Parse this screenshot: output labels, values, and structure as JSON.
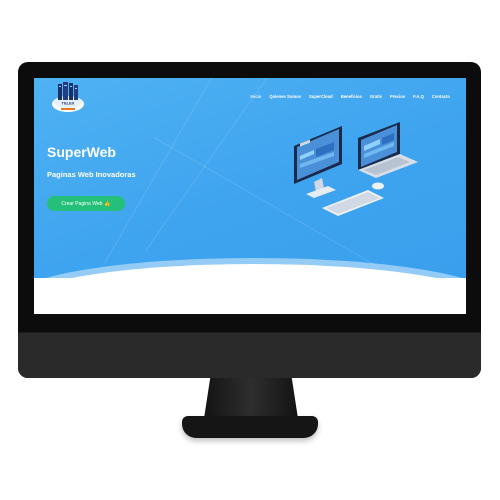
{
  "nav": {
    "items": [
      {
        "label": "Inicio",
        "active": true
      },
      {
        "label": "Quienes Somos"
      },
      {
        "label": "SuperCloud"
      },
      {
        "label": "Beneficios"
      },
      {
        "label": "Gratis"
      },
      {
        "label": "Precios"
      },
      {
        "label": "F.A.Q"
      },
      {
        "label": "Contacto"
      }
    ]
  },
  "logo": {
    "text": "TELEX"
  },
  "hero": {
    "title": "SuperWeb",
    "subtitle": "Paginas Web Inovadoras",
    "cta_label": "Crear Pagina Web",
    "cta_icon": "thumbs-up-icon"
  },
  "colors": {
    "hero_bg": "#3fa4ef",
    "cta_bg": "#24c07a",
    "bezel": "#0c0c0c"
  }
}
